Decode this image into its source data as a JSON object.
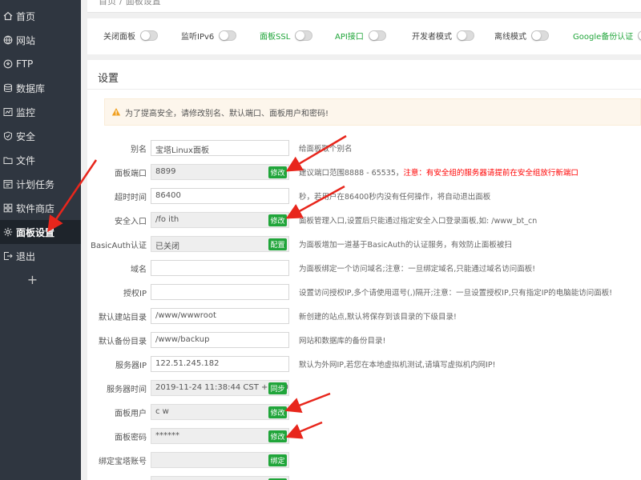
{
  "sidebar": {
    "items": [
      {
        "label": "首页",
        "icon": "home-icon"
      },
      {
        "label": "网站",
        "icon": "globe-icon"
      },
      {
        "label": "FTP",
        "icon": "ftp-icon"
      },
      {
        "label": "数据库",
        "icon": "database-icon"
      },
      {
        "label": "监控",
        "icon": "monitor-icon"
      },
      {
        "label": "安全",
        "icon": "shield-icon"
      },
      {
        "label": "文件",
        "icon": "folder-icon"
      },
      {
        "label": "计划任务",
        "icon": "clock-icon"
      },
      {
        "label": "软件商店",
        "icon": "store-icon"
      },
      {
        "label": "面板设置",
        "icon": "gear-icon"
      },
      {
        "label": "退出",
        "icon": "logout-icon"
      }
    ],
    "add_label": "+",
    "active_index": 9
  },
  "breadcrumb": {
    "home": "首页",
    "sep": "/",
    "current": "面板设置"
  },
  "toggles": [
    {
      "label": "关闭面板",
      "state": "off"
    },
    {
      "label": "监听IPv6",
      "state": "off"
    },
    {
      "label": "面板SSL",
      "state": "off"
    },
    {
      "label": "API接口",
      "state": "off"
    },
    {
      "label": "开发者模式",
      "state": "off"
    },
    {
      "label": "离线模式",
      "state": "off"
    },
    {
      "label": "Google备份认证",
      "state": "off"
    }
  ],
  "settings": {
    "title": "设置",
    "warning": "为了提高安全，请修改别名、默认端口、面板用户和密码!",
    "rows": [
      {
        "label": "别名",
        "value": "宝塔Linux面板",
        "button": "",
        "hint": "给面板取个别名"
      },
      {
        "label": "面板端口",
        "value": "8899",
        "button": "修改",
        "hint": "建议端口范围8888 - 65535，",
        "hint_red": "注意：有安全组的服务器请提前在安全组放行新端口"
      },
      {
        "label": "超时时间",
        "value": "86400",
        "button": "",
        "hint": "秒，若用户在86400秒内没有任何操作，将自动退出面板"
      },
      {
        "label": "安全入口",
        "value": "/fo        ith",
        "button": "修改",
        "hint": "面板管理入口,设置后只能通过指定安全入口登录面板,如: /www_bt_cn"
      },
      {
        "label": "BasicAuth认证",
        "value": "已关闭",
        "button": "配置",
        "hint": "为面板增加一道基于BasicAuth的认证服务，有效防止面板被扫"
      },
      {
        "label": "域名",
        "value": "",
        "button": "",
        "hint": "为面板绑定一个访问域名;注意：一旦绑定域名,只能通过域名访问面板!"
      },
      {
        "label": "授权IP",
        "value": "",
        "button": "",
        "hint": "设置访问授权IP,多个请使用逗号(,)隔开;注意：一旦设置授权IP,只有指定IP的电脑能访问面板!"
      },
      {
        "label": "默认建站目录",
        "value": "/www/wwwroot",
        "button": "",
        "hint": "新创建的站点,默认将保存到该目录的下级目录!"
      },
      {
        "label": "默认备份目录",
        "value": "/www/backup",
        "button": "",
        "hint": "网站和数据库的备份目录!"
      },
      {
        "label": "服务器IP",
        "value": "122.51.245.182",
        "button": "",
        "hint": "默认为外网IP,若您在本地虚拟机测试,请填写虚拟机内网IP!"
      },
      {
        "label": "服务器时间",
        "value": "2019-11-24 11:38:44 CST +0800",
        "button": "同步",
        "hint": ""
      },
      {
        "label": "面板用户",
        "value": "c    w",
        "button": "修改",
        "hint": ""
      },
      {
        "label": "面板密码",
        "value": "******",
        "button": "修改",
        "hint": ""
      },
      {
        "label": "绑定宝塔账号",
        "value": "",
        "button": "绑定",
        "hint": ""
      }
    ]
  },
  "colors": {
    "sidebar_bg": "#2f3640",
    "accent_green": "#20a53a",
    "arrow_red": "#e8261c"
  }
}
